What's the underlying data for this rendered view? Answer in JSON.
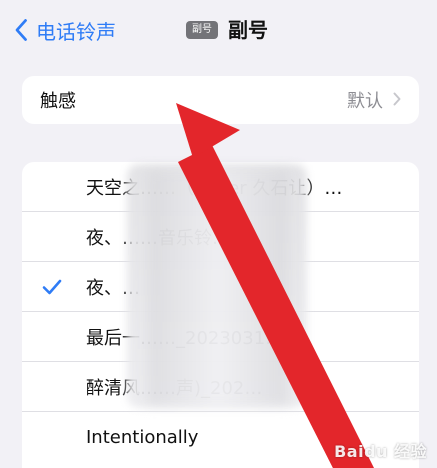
{
  "nav": {
    "back_label": "电话铃声",
    "sim_badge": "副号",
    "title": "副号"
  },
  "haptics": {
    "label": "触感",
    "value": "默认"
  },
  "ringtones": [
    {
      "label": "天空之……（Cover 久石让）…",
      "selected": false
    },
    {
      "label": "夜、……音乐铃…",
      "selected": false
    },
    {
      "label": "夜、…",
      "selected": true
    },
    {
      "label": "最后一……_2023031…",
      "selected": false
    },
    {
      "label": "醉清风……声)_202…",
      "selected": false
    },
    {
      "label": "Intentionally",
      "selected": false
    }
  ],
  "watermark": "Baidu 经验",
  "colors": {
    "accent": "#2f7cf6",
    "arrow": "#e3262b",
    "background": "#f2f1f6"
  },
  "icons": {
    "back": "chevron-left-icon",
    "disclosure": "chevron-right-icon",
    "selected": "checkmark-icon"
  }
}
